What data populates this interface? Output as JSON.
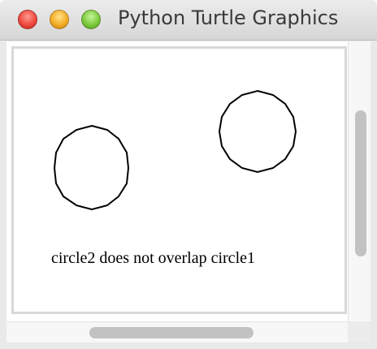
{
  "window": {
    "title": "Python Turtle Graphics",
    "controls": [
      "close-button",
      "minimize-button",
      "zoom-button"
    ]
  },
  "canvas": {
    "message": "circle2 does not overlap circle1",
    "stroke_color": "#000000",
    "background": "#ffffff"
  },
  "colors": {
    "close": "#ef4b40",
    "minimize": "#f4ad26",
    "zoom": "#7ecb3e",
    "scroll_thumb": "#c2c2c2"
  }
}
